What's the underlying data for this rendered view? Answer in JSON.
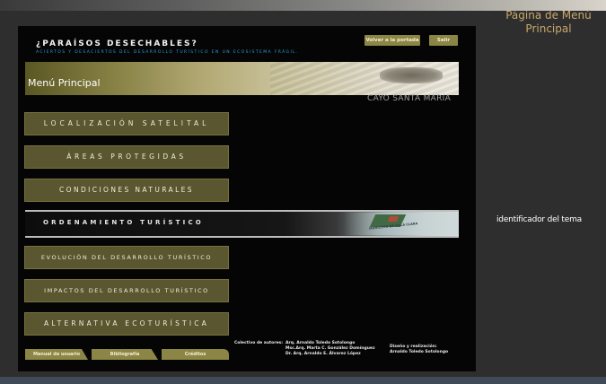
{
  "header": {
    "title": "¿PARAÍSOS DESECHABLES?",
    "subtitle": "ACIERTOS Y DESACIERTOS DEL DESARROLLO TURÍSTICO EN UN ECOSISTEMA FRÁGIL.",
    "back_button": "Volver a la portada",
    "exit_button": "Salir"
  },
  "banner": {
    "label": "Menú Principal",
    "place": "CAYO SANTA MARÍA"
  },
  "menu": {
    "items": [
      "LOCALIZACIÓN SATELITAL",
      "ÁREAS PROTEGIDAS",
      "CONDICIONES NATURALES",
      "ORDENAMIENTO TURÍSTICO",
      "EVOLUCIÓN DEL DESARROLLO TURÍSTICO",
      "IMPACTOS DEL DESARROLLO TURÍSTICO",
      "ALTERNATIVA ECOTURÍSTICA"
    ],
    "active_map_text": "MUNICIPIO DE VILLA CLARA"
  },
  "footer": {
    "buttons": [
      "Manual de usuario",
      "Bibliografía",
      "Créditos"
    ],
    "authors_label": "Colectivo de autores:",
    "authors": [
      "Arq. Arnaldo Toledo Sotolongo",
      "Msc.Arq. Marta C. González Domínguez",
      "Dr. Arq. Arnaldo E. Álvarez López"
    ],
    "design_label": "Diseño y realización:",
    "design_author": "Arnaldo Toledo Sotolongo"
  },
  "annotations": {
    "page_title": "Página de Menú Principal",
    "theme_id": "identificador del tema"
  },
  "colors": {
    "accent_button": "#8c8646",
    "menu_button": "#5a5630",
    "subtitle": "#2a9fd6",
    "annotation": "#c9a86a"
  }
}
